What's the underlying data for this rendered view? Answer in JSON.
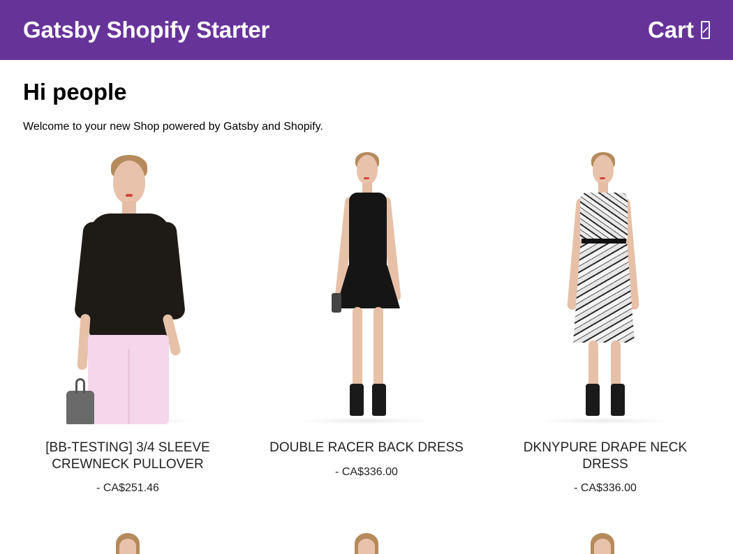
{
  "header": {
    "title": "Gatsby Shopify Starter",
    "cart_label": "Cart",
    "cart_icon": "shopping-bag-icon"
  },
  "colors": {
    "brand": "#663399",
    "header_text": "#ffffff",
    "body_text": "#000000"
  },
  "main": {
    "heading": "Hi people",
    "intro": "Welcome to your new Shop powered by Gatsby and Shopify."
  },
  "products": [
    {
      "name": "[BB-TESTING] 3/4 SLEEVE CREWNECK PULLOVER",
      "price": "- CA$251.46",
      "image": "model-black-pullover-pink-pants"
    },
    {
      "name": "DOUBLE RACER BACK DRESS",
      "price": "- CA$336.00",
      "image": "model-black-dress"
    },
    {
      "name": "DKNYPURE DRAPE NECK DRESS",
      "price": "- CA$336.00",
      "image": "model-printed-dress"
    }
  ]
}
